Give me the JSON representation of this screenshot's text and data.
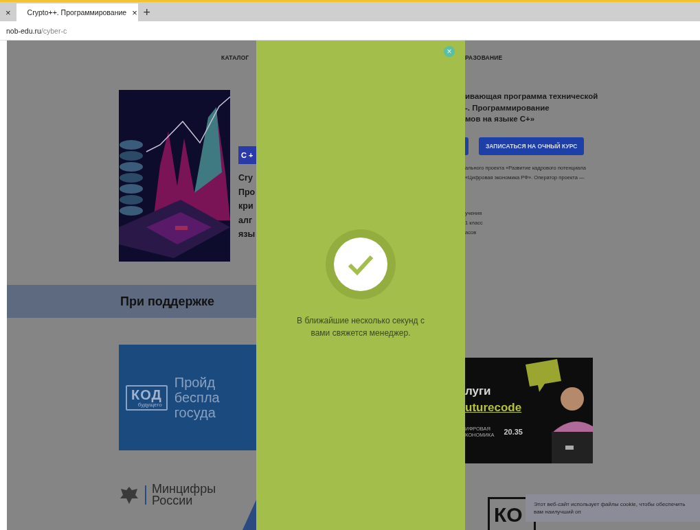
{
  "browser": {
    "tabs": [
      {
        "close": "×",
        "selected": false
      },
      {
        "title": "Crypto++. Программирование",
        "close": "×",
        "selected": true
      }
    ],
    "new_tab": "+",
    "address": {
      "host": "nob-edu.ru",
      "path": "/cyber-c"
    }
  },
  "page": {
    "nav": [
      "КАТАЛОГ",
      "РАЗОВАНИЕ"
    ],
    "hero": {
      "badge": "C +",
      "title_lines": [
        "Cry",
        "Про",
        "кри",
        "алг",
        "язы"
      ],
      "description_lines": [
        "ивающая программа технической",
        "-. Программирование",
        "мов на языке С+»"
      ],
      "button": "ЗАПИСАТЬСЯ НА ОЧНЫЙ КУРС",
      "note_lines": [
        "ального проекта «Развитие кадрового потенциала",
        "«Цифровая экономика РФ». Оператор проекта —"
      ],
      "facts": [
        "учения",
        "1 класс",
        "асов"
      ]
    },
    "support": {
      "heading": "При поддержке",
      "banner_left": {
        "logo": "КОД",
        "logo_sub": "будущего",
        "lines": [
          "Пройд",
          "беспла",
          "госуда"
        ]
      },
      "banner_right": {
        "lines": [
          "луги",
          "uturecode"
        ],
        "small_lines": [
          "ИФРОВАЯ",
          "КОНОМИКА"
        ],
        "number": "20.35"
      },
      "ministry": [
        "Минцифры",
        "России"
      ],
      "code_logo": "КО"
    },
    "cookie": "Этот веб-сайт использует файлы cookie, чтобы обеспечить вам наилучший оп"
  },
  "modal": {
    "close": "×",
    "message": "В ближайшие несколько секунд с вами свяжется менеджер."
  }
}
